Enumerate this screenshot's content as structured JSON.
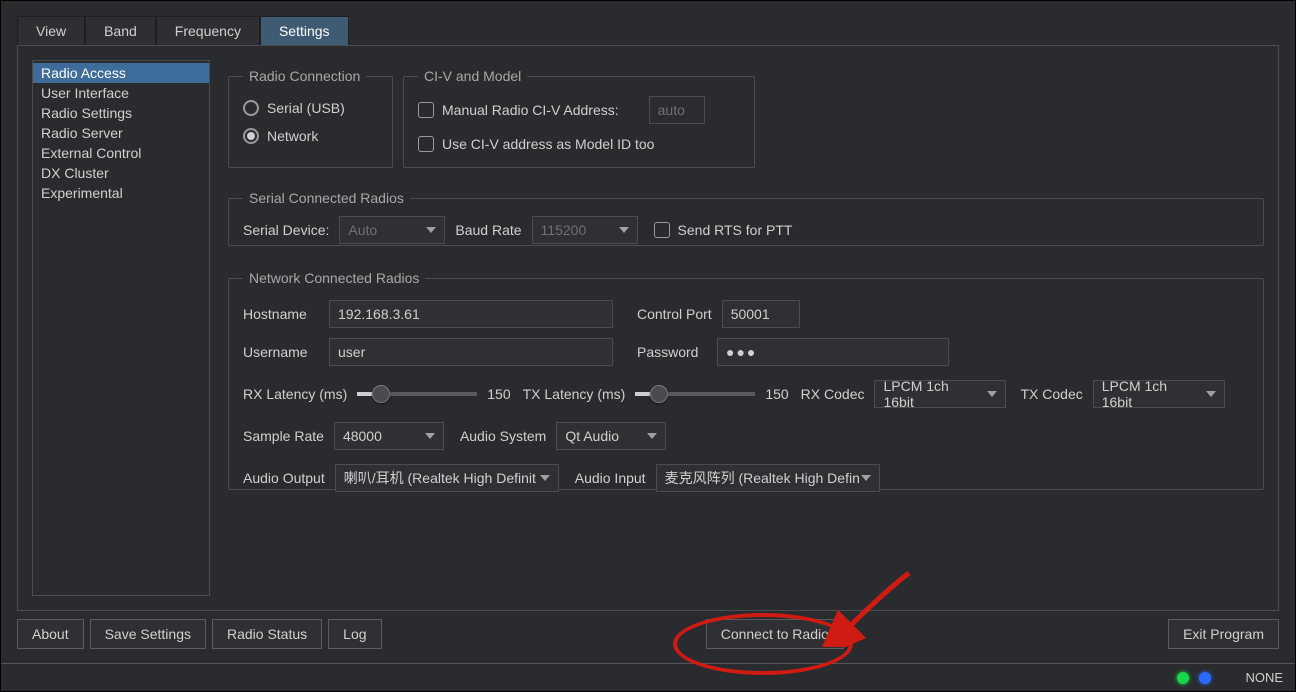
{
  "tabs": {
    "view": "View",
    "band": "Band",
    "frequency": "Frequency",
    "settings": "Settings"
  },
  "side": {
    "items": [
      "Radio Access",
      "User Interface",
      "Radio Settings",
      "Radio Server",
      "External Control",
      "DX Cluster",
      "Experimental"
    ],
    "active": 0
  },
  "radioconn": {
    "legend": "Radio Connection",
    "serial": "Serial (USB)",
    "network": "Network",
    "selected": "network"
  },
  "civ": {
    "legend": "CI-V and Model",
    "manual_label": "Manual Radio CI-V Address:",
    "manual_placeholder": "auto",
    "asmodel_label": "Use CI-V address as Model ID too"
  },
  "serial": {
    "legend": "Serial Connected Radios",
    "device_label": "Serial Device:",
    "device_value": "Auto",
    "baud_label": "Baud Rate",
    "baud_value": "115200",
    "rtsptt_label": "Send RTS for PTT"
  },
  "network": {
    "legend": "Network Connected Radios",
    "host_label": "Hostname",
    "host_value": "192.168.3.61",
    "cport_label": "Control Port",
    "cport_value": "50001",
    "user_label": "Username",
    "user_value": "user",
    "pass_label": "Password",
    "pass_value": "●●●",
    "rxlat_label": "RX Latency (ms)",
    "rxlat_value": "150",
    "txlat_label": "TX Latency (ms)",
    "txlat_value": "150",
    "rxcodec_label": "RX Codec",
    "rxcodec_value": "LPCM 1ch 16bit",
    "txcodec_label": "TX Codec",
    "txcodec_value": "LPCM 1ch 16bit",
    "sr_label": "Sample Rate",
    "sr_value": "48000",
    "asys_label": "Audio System",
    "asys_value": "Qt Audio",
    "aout_label": "Audio Output",
    "aout_value": "喇叭/耳机 (Realtek High Definit",
    "ain_label": "Audio Input",
    "ain_value": "麦克风阵列 (Realtek High Defin"
  },
  "footer": {
    "about": "About",
    "save": "Save Settings",
    "radiostatus": "Radio Status",
    "log": "Log",
    "connect": "Connect to Radio",
    "exit": "Exit Program"
  },
  "status": {
    "text": "NONE"
  },
  "colors": {
    "annotation": "#d01b12"
  }
}
